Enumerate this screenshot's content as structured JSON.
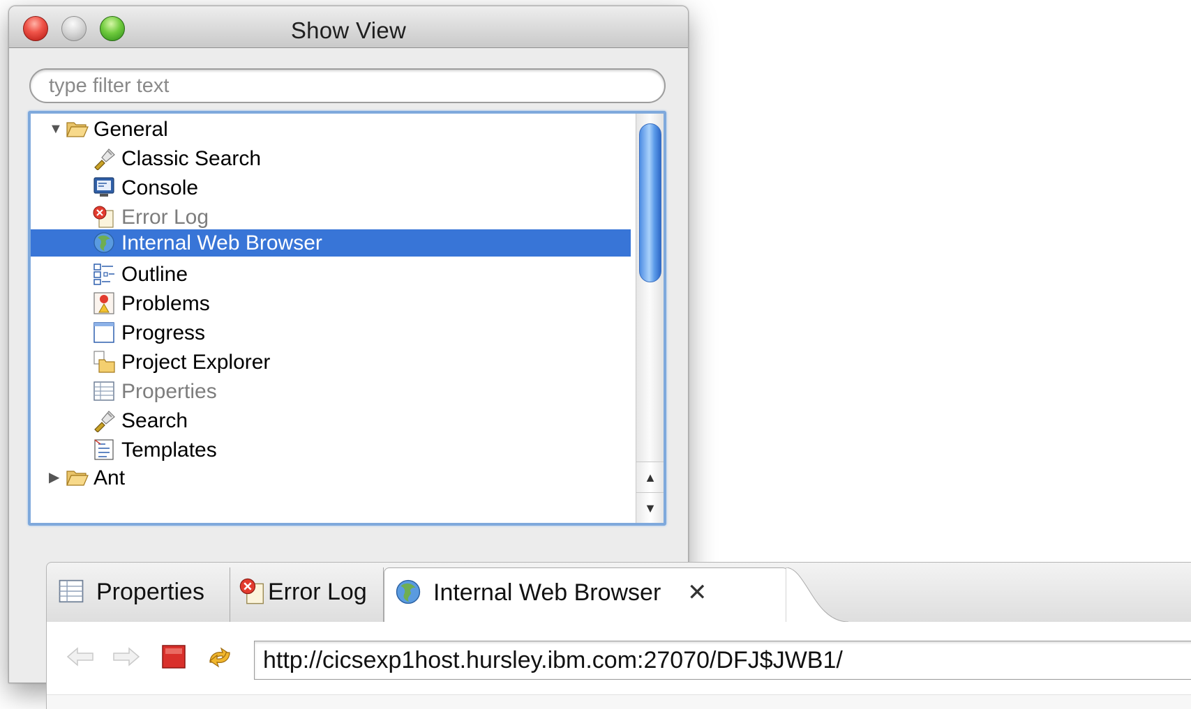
{
  "dialog": {
    "title": "Show View",
    "filter_placeholder": "type filter text",
    "tree": [
      {
        "label": "General",
        "icon": "folder-open-icon",
        "expanded": true,
        "depth": 0
      },
      {
        "label": "Classic Search",
        "icon": "flashlight-icon",
        "depth": 1
      },
      {
        "label": "Console",
        "icon": "console-monitor-icon",
        "depth": 1
      },
      {
        "label": "Error Log",
        "icon": "error-log-icon",
        "depth": 1,
        "disabled": true
      },
      {
        "label": "Internal Web Browser",
        "icon": "globe-icon",
        "depth": 1,
        "selected": true
      },
      {
        "label": "Outline",
        "icon": "outline-icon",
        "depth": 1
      },
      {
        "label": "Problems",
        "icon": "problems-icon",
        "depth": 1
      },
      {
        "label": "Progress",
        "icon": "progress-icon",
        "depth": 1
      },
      {
        "label": "Project Explorer",
        "icon": "project-explorer-icon",
        "depth": 1
      },
      {
        "label": "Properties",
        "icon": "properties-icon",
        "depth": 1,
        "disabled": true
      },
      {
        "label": "Search",
        "icon": "flashlight-icon",
        "depth": 1
      },
      {
        "label": "Templates",
        "icon": "templates-icon",
        "depth": 1
      },
      {
        "label": "Ant",
        "icon": "folder-icon",
        "expanded": false,
        "depth": 0
      }
    ]
  },
  "views": {
    "tabs": [
      {
        "label": "Properties",
        "icon": "properties-icon"
      },
      {
        "label": "Error Log",
        "icon": "error-log-icon"
      },
      {
        "label": "Internal Web Browser",
        "icon": "globe-icon",
        "active": true
      }
    ],
    "browser": {
      "url": "http://cicsexp1host.hursley.ibm.com:27070/DFJ$JWB1/",
      "buttons": [
        "back-icon",
        "forward-icon",
        "stop-icon",
        "refresh-icon"
      ]
    }
  },
  "colors": {
    "selection": "#3875d7",
    "tree_border": "#7fa9dc",
    "stop_red": "#d9302b"
  }
}
